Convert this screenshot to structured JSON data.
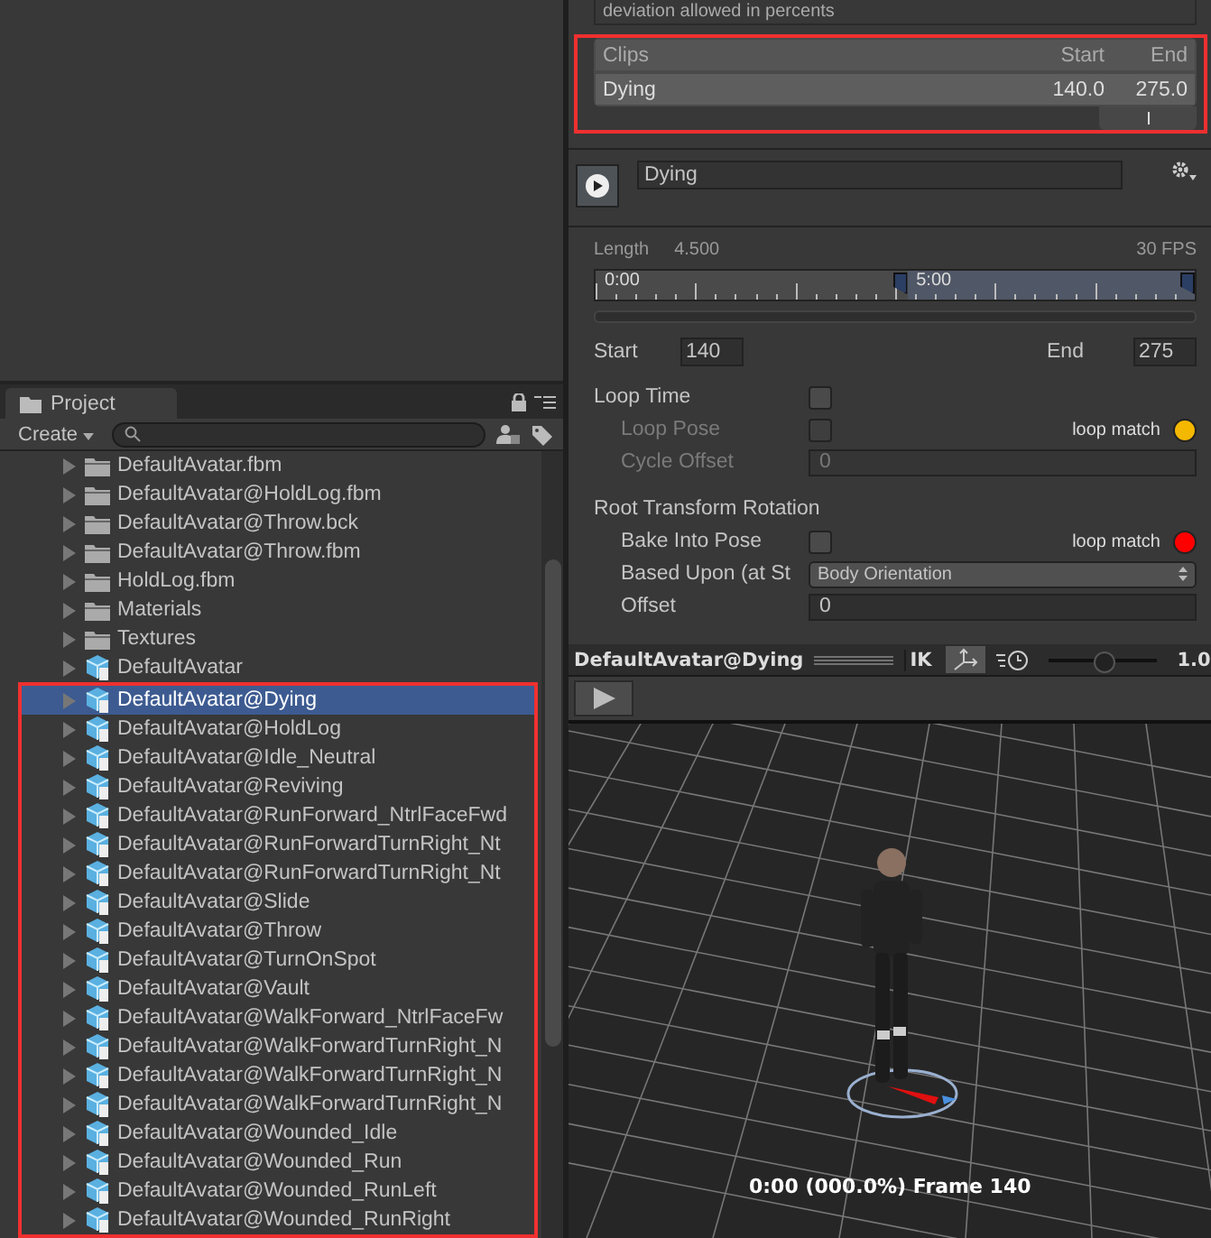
{
  "project_panel": {
    "tab": "Project",
    "create_button": "Create",
    "items": [
      {
        "name": "DefaultAvatar.fbm",
        "kind": "folder",
        "selected": false,
        "highlighted": false
      },
      {
        "name": "DefaultAvatar@HoldLog.fbm",
        "kind": "folder",
        "selected": false,
        "highlighted": false
      },
      {
        "name": "DefaultAvatar@Throw.bck",
        "kind": "folder",
        "selected": false,
        "highlighted": false
      },
      {
        "name": "DefaultAvatar@Throw.fbm",
        "kind": "folder",
        "selected": false,
        "highlighted": false
      },
      {
        "name": "HoldLog.fbm",
        "kind": "folder",
        "selected": false,
        "highlighted": false
      },
      {
        "name": "Materials",
        "kind": "folder",
        "selected": false,
        "highlighted": false
      },
      {
        "name": "Textures",
        "kind": "folder",
        "selected": false,
        "highlighted": false
      },
      {
        "name": "DefaultAvatar",
        "kind": "model",
        "selected": false,
        "highlighted": false
      },
      {
        "name": "DefaultAvatar@Dying",
        "kind": "model",
        "selected": true,
        "highlighted": true
      },
      {
        "name": "DefaultAvatar@HoldLog",
        "kind": "model",
        "selected": false,
        "highlighted": true
      },
      {
        "name": "DefaultAvatar@Idle_Neutral",
        "kind": "model",
        "selected": false,
        "highlighted": true
      },
      {
        "name": "DefaultAvatar@Reviving",
        "kind": "model",
        "selected": false,
        "highlighted": true
      },
      {
        "name": "DefaultAvatar@RunForward_NtrlFaceFwd",
        "kind": "model",
        "selected": false,
        "highlighted": true
      },
      {
        "name": "DefaultAvatar@RunForwardTurnRight_Nt",
        "kind": "model",
        "selected": false,
        "highlighted": true
      },
      {
        "name": "DefaultAvatar@RunForwardTurnRight_Nt",
        "kind": "model",
        "selected": false,
        "highlighted": true
      },
      {
        "name": "DefaultAvatar@Slide",
        "kind": "model",
        "selected": false,
        "highlighted": true
      },
      {
        "name": "DefaultAvatar@Throw",
        "kind": "model",
        "selected": false,
        "highlighted": true
      },
      {
        "name": "DefaultAvatar@TurnOnSpot",
        "kind": "model",
        "selected": false,
        "highlighted": true
      },
      {
        "name": "DefaultAvatar@Vault",
        "kind": "model",
        "selected": false,
        "highlighted": true
      },
      {
        "name": "DefaultAvatar@WalkForward_NtrlFaceFw",
        "kind": "model",
        "selected": false,
        "highlighted": true
      },
      {
        "name": "DefaultAvatar@WalkForwardTurnRight_N",
        "kind": "model",
        "selected": false,
        "highlighted": true
      },
      {
        "name": "DefaultAvatar@WalkForwardTurnRight_N",
        "kind": "model",
        "selected": false,
        "highlighted": true
      },
      {
        "name": "DefaultAvatar@WalkForwardTurnRight_N",
        "kind": "model",
        "selected": false,
        "highlighted": true
      },
      {
        "name": "DefaultAvatar@Wounded_Idle",
        "kind": "model",
        "selected": false,
        "highlighted": true
      },
      {
        "name": "DefaultAvatar@Wounded_Run",
        "kind": "model",
        "selected": false,
        "highlighted": true
      },
      {
        "name": "DefaultAvatar@Wounded_RunLeft",
        "kind": "model",
        "selected": false,
        "highlighted": true
      },
      {
        "name": "DefaultAvatar@Wounded_RunRight",
        "kind": "model",
        "selected": false,
        "highlighted": true
      }
    ]
  },
  "inspector": {
    "help_text": "deviation allowed in percents",
    "clips_table": {
      "highlighted": true,
      "columns": [
        "Clips",
        "Start",
        "End"
      ],
      "rows": [
        {
          "name": "Dying",
          "start": "140.0",
          "end": "275.0"
        }
      ]
    },
    "clip": {
      "name": "Dying",
      "length_label": "Length",
      "length": "4.500",
      "fps": "30 FPS",
      "timeline": {
        "labels": [
          "0:00",
          "5:00"
        ],
        "handles": [
          {
            "level": 0.52
          },
          {
            "level": 1.0
          }
        ]
      },
      "start_label": "Start",
      "start": "140",
      "end_label": "End",
      "end": "275",
      "settings": [
        {
          "kind": "checkbox",
          "label": "Loop Time",
          "checked": false,
          "disabled": false,
          "children": [
            {
              "kind": "checkbox",
              "label": "Loop Pose",
              "checked": false,
              "disabled": true,
              "match_label": "loop match",
              "color": "#f5b800"
            },
            {
              "kind": "field",
              "label": "Cycle Offset",
              "value": "0",
              "disabled": true
            }
          ]
        },
        {
          "kind": "heading",
          "label": "Root Transform Rotation",
          "children": [
            {
              "kind": "checkbox",
              "label": "Bake Into Pose",
              "checked": false,
              "disabled": false,
              "match_label": "loop match",
              "color": "#ff0000"
            },
            {
              "kind": "dropdown",
              "label": "Based Upon (at St",
              "value": "Body Orientation",
              "disabled": false
            },
            {
              "kind": "field",
              "label": "Offset",
              "value": "0",
              "disabled": false
            }
          ]
        }
      ]
    }
  },
  "preview": {
    "title": "DefaultAvatar@Dying",
    "ik": "IK",
    "speed_slider": {
      "level": 0.5
    },
    "speed": "1.0",
    "status": "0:00 (000.0%) Frame 140"
  }
}
